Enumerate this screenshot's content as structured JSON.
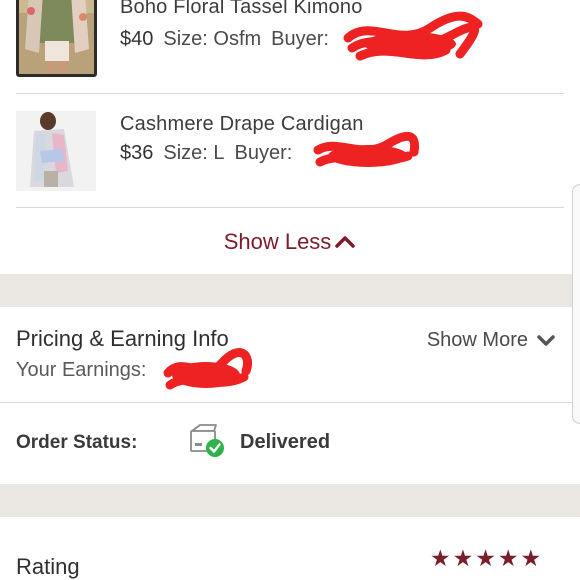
{
  "items": [
    {
      "title": "Boho Floral Tassel Kimono",
      "price": "$40",
      "size_label": "Size: Osfm",
      "buyer_label": "Buyer:"
    },
    {
      "title": "Cashmere Drape Cardigan",
      "price": "$36",
      "size_label": "Size: L",
      "buyer_label": "Buyer:"
    }
  ],
  "show_less_label": "Show Less",
  "pricing": {
    "heading": "Pricing & Earning Info",
    "earnings_label": "Your Earnings:",
    "show_more_label": "Show More"
  },
  "order_status": {
    "label": "Order Status:",
    "value": "Delivered",
    "icon": "package-delivered-icon"
  },
  "rating": {
    "label": "Rating",
    "stars": 5
  },
  "colors": {
    "accent": "#7b1d2b",
    "redaction": "#ee2222",
    "success": "#2fb24a",
    "separator": "#eae7e2"
  }
}
